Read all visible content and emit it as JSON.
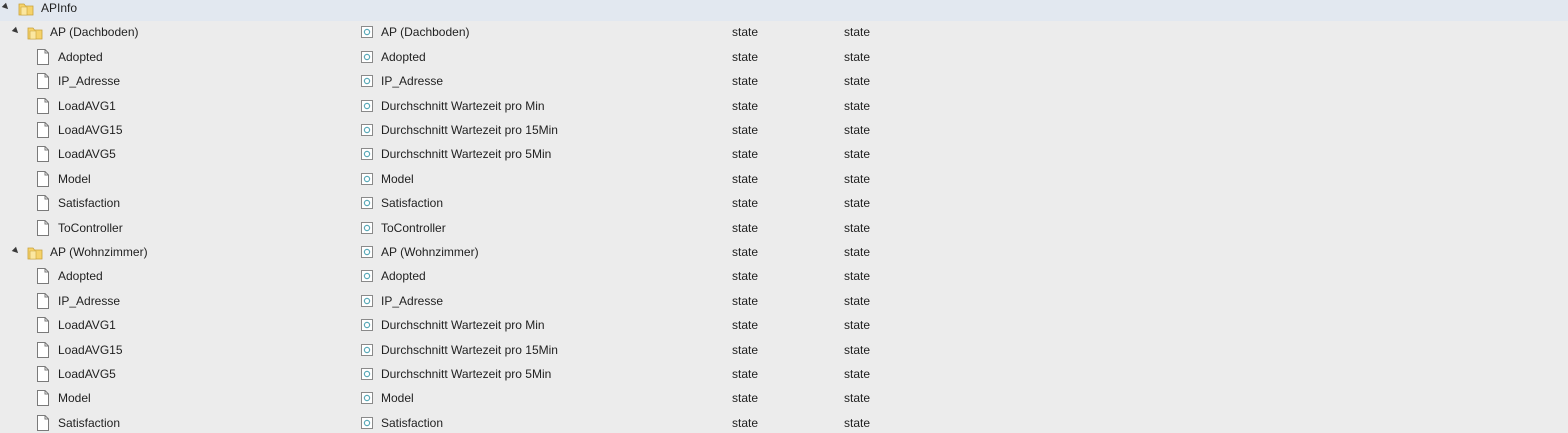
{
  "tree": {
    "root": {
      "label": "APInfo",
      "expanded": true
    },
    "groups": [
      {
        "label": "AP (Dachboden)",
        "description": "AP (Dachboden)",
        "type": "state",
        "role": "state",
        "expanded": true,
        "children": [
          {
            "name": "Adopted",
            "description": "Adopted",
            "type": "state",
            "role": "state"
          },
          {
            "name": "IP_Adresse",
            "description": "IP_Adresse",
            "type": "state",
            "role": "state"
          },
          {
            "name": "LoadAVG1",
            "description": "Durchschnitt Wartezeit pro Min",
            "type": "state",
            "role": "state"
          },
          {
            "name": "LoadAVG15",
            "description": "Durchschnitt Wartezeit pro 15Min",
            "type": "state",
            "role": "state"
          },
          {
            "name": "LoadAVG5",
            "description": "Durchschnitt Wartezeit pro 5Min",
            "type": "state",
            "role": "state"
          },
          {
            "name": "Model",
            "description": "Model",
            "type": "state",
            "role": "state"
          },
          {
            "name": "Satisfaction",
            "description": "Satisfaction",
            "type": "state",
            "role": "state"
          },
          {
            "name": "ToController",
            "description": "ToController",
            "type": "state",
            "role": "state"
          }
        ]
      },
      {
        "label": "AP (Wohnzimmer)",
        "description": "AP (Wohnzimmer)",
        "type": "state",
        "role": "state",
        "expanded": true,
        "children": [
          {
            "name": "Adopted",
            "description": "Adopted",
            "type": "state",
            "role": "state"
          },
          {
            "name": "IP_Adresse",
            "description": "IP_Adresse",
            "type": "state",
            "role": "state"
          },
          {
            "name": "LoadAVG1",
            "description": "Durchschnitt Wartezeit pro Min",
            "type": "state",
            "role": "state"
          },
          {
            "name": "LoadAVG15",
            "description": "Durchschnitt Wartezeit pro 15Min",
            "type": "state",
            "role": "state"
          },
          {
            "name": "LoadAVG5",
            "description": "Durchschnitt Wartezeit pro 5Min",
            "type": "state",
            "role": "state"
          },
          {
            "name": "Model",
            "description": "Model",
            "type": "state",
            "role": "state"
          },
          {
            "name": "Satisfaction",
            "description": "Satisfaction",
            "type": "state",
            "role": "state"
          }
        ]
      }
    ],
    "icons": {
      "toggle": "expanded-triangle-icon",
      "folder": "folder-icon",
      "file": "file-icon",
      "description": "info-icon"
    },
    "colors": {
      "background": "#ececec",
      "folder": "#f2c94c",
      "icon_accent": "#5aa9b8"
    }
  }
}
